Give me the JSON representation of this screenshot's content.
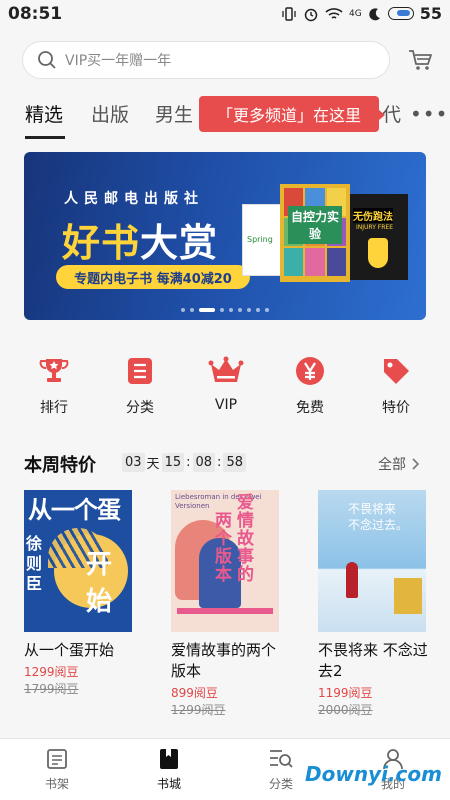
{
  "status": {
    "time": "08:51",
    "battery": "55",
    "network": "4G"
  },
  "search": {
    "placeholder": "VIP买一年赠一年"
  },
  "tabs": [
    {
      "label": "精选",
      "active": true
    },
    {
      "label": "出版",
      "active": false
    },
    {
      "label": "男生",
      "active": false
    },
    {
      "label": "代",
      "active": false
    }
  ],
  "tooltip": "「更多频道」在这里",
  "more_label": "•••",
  "banner": {
    "publisher": "人民邮电出版社",
    "title_yellow": "好书",
    "title_white": "大赏",
    "promo": "专题内电子书  每满40减20",
    "book_a": "Spring",
    "book_b": "自控力实验",
    "book_c": "无伤跑法",
    "book_c_sub": "INJURY FREE",
    "dot_count": 9,
    "active_dot": 2
  },
  "categories": [
    {
      "label": "排行",
      "icon": "trophy-icon"
    },
    {
      "label": "分类",
      "icon": "list-icon"
    },
    {
      "label": "VIP",
      "icon": "crown-icon"
    },
    {
      "label": "免费",
      "icon": "yen-icon"
    },
    {
      "label": "特价",
      "icon": "tag-icon"
    }
  ],
  "weekly": {
    "title": "本周特价",
    "timer": {
      "days": "03",
      "day_unit": "天",
      "hours": "15",
      "minutes": "08",
      "seconds": "58"
    },
    "all_label": "全部",
    "books": [
      {
        "name": "从一个蛋开始",
        "price": "1299阅豆",
        "orig_price": "1799阅豆",
        "cover_text": "从一个蛋",
        "cover_text2": "开始",
        "cover_author": "徐则臣"
      },
      {
        "name": "爱情故事的两个版本",
        "price": "899阅豆",
        "orig_price": "1299阅豆",
        "cover_text": "爱情故事的",
        "cover_text2": "两个版本",
        "cover_en": "Liebesroman in der Zwei Versionen"
      },
      {
        "name": "不畏将来 不念过去2",
        "price": "1199阅豆",
        "orig_price": "2000阅豆",
        "cover_text": "不畏将来",
        "cover_text2": "不念过去。"
      }
    ]
  },
  "bottom_nav": [
    {
      "label": "书架",
      "icon": "bookshelf-icon",
      "active": false
    },
    {
      "label": "书城",
      "icon": "bookstore-icon",
      "active": true
    },
    {
      "label": "分类",
      "icon": "category-search-icon",
      "active": false
    },
    {
      "label": "我的",
      "icon": "user-icon",
      "active": false
    }
  ],
  "watermark": "Downyi.com",
  "colors": {
    "accent": "#e84d4d",
    "banner": "#1f4fa8",
    "banner_highlight": "#ffd43a"
  }
}
